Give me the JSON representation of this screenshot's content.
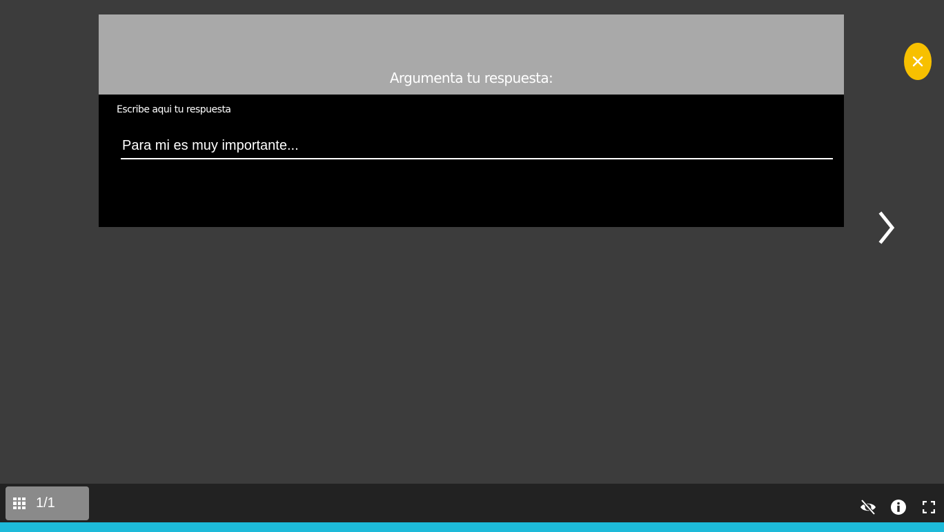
{
  "question": {
    "title": "Argumenta tu respuesta:",
    "field_label": "Escribe aqui tu respuesta",
    "input_value": "",
    "input_placeholder": "Para mi es muy importante..."
  },
  "navigation": {
    "close_icon": "close-icon",
    "next_icon": "chevron-right-icon"
  },
  "bottom_bar": {
    "page_indicator": "1/1",
    "grid_icon": "grid-icon",
    "tools": [
      "visibility-off-icon",
      "info-icon",
      "fullscreen-icon"
    ]
  },
  "colors": {
    "background": "#3c3c3c",
    "header": "#a9a9a9",
    "accent_yellow": "#f7c000",
    "progress_bar": "#1dbad9",
    "bottom_bar": "#222222"
  }
}
